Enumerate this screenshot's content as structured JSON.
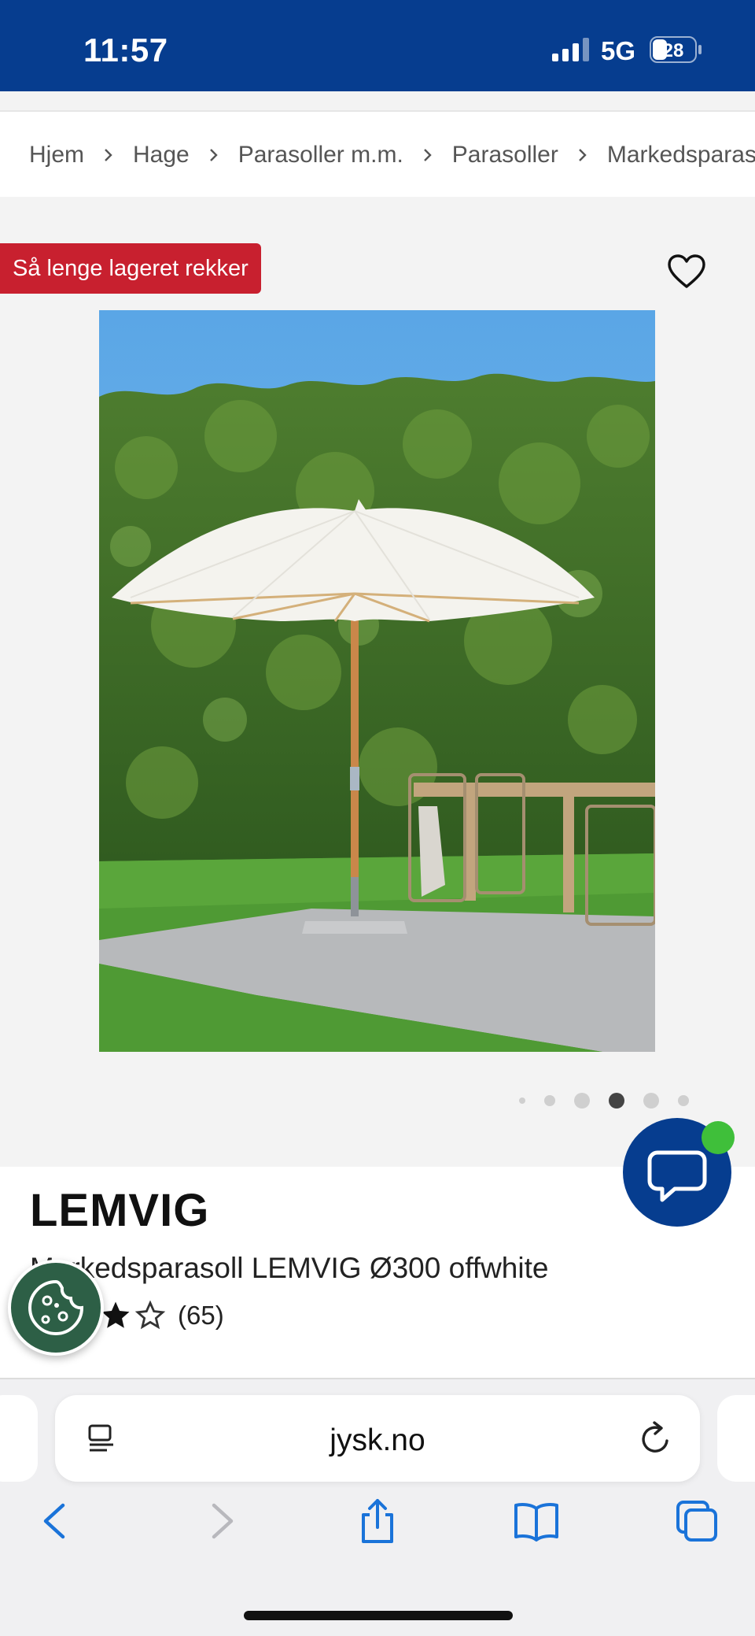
{
  "status_bar": {
    "time": "11:57",
    "network": "5G",
    "battery": "28"
  },
  "breadcrumb": [
    "Hjem",
    "Hage",
    "Parasoller m.m.",
    "Parasoller",
    "Markedsparasoller"
  ],
  "product": {
    "badge": "Så lenge lageret rekker",
    "brand": "LEMVIG",
    "name": "Markedsparasoll LEMVIG Ø300 offwhite",
    "rating": {
      "value": 3,
      "max": 5,
      "count": "(65)"
    },
    "carousel": {
      "total": 6,
      "active": 4
    }
  },
  "browser": {
    "url": "jysk.no"
  },
  "colors": {
    "brand_blue": "#063d8f",
    "badge_red": "#c8202f",
    "online_green": "#3fbf3a"
  }
}
